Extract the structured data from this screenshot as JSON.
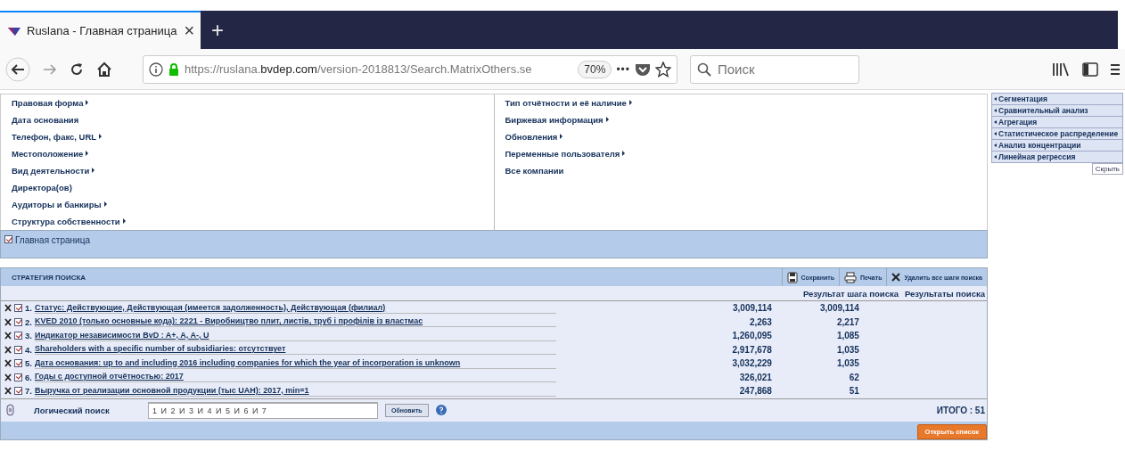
{
  "browser": {
    "tab": {
      "title": "Ruslana - Главная страница",
      "close": "×"
    },
    "new_tab": "+",
    "url": "https://ruslana.**bvdep.com**/version-2018813/Search.MatrixOthers.se",
    "zoom": "70%",
    "more": "•••",
    "search": {
      "placeholder": "Поиск"
    }
  },
  "criteria": {
    "left": [
      {
        "label": "Правовая форма",
        "submenu": true
      },
      {
        "label": "Дата основания",
        "submenu": false
      },
      {
        "label": "Телефон, факс, URL",
        "submenu": true
      },
      {
        "label": "Местоположение",
        "submenu": true
      },
      {
        "label": "Вид деятельности",
        "submenu": true
      },
      {
        "label": "Директора(ов)",
        "submenu": false
      },
      {
        "label": "Аудиторы и банкиры",
        "submenu": true
      },
      {
        "label": "Структура собственности",
        "submenu": true
      }
    ],
    "right": [
      {
        "label": "Тип отчётности и её наличие",
        "submenu": true
      },
      {
        "label": "Биржевая информация",
        "submenu": true
      },
      {
        "label": "Обновления",
        "submenu": true
      },
      {
        "label": "Переменные пользователя",
        "submenu": true
      },
      {
        "label": "Все компании",
        "submenu": false
      }
    ]
  },
  "home_bar": {
    "label": "Главная страница",
    "checked": true
  },
  "sidebar": {
    "items": [
      "Сегментация",
      "Сравнительный анализ",
      "Агрегация",
      "Статистическое распределение",
      "Анализ концентрации",
      "Линейная регрессия"
    ],
    "hide_button": "Скрыть"
  },
  "strategy": {
    "title": "СТРАТЕГИЯ ПОИСКА",
    "actions": [
      {
        "kind": "save",
        "label": "Сохранить"
      },
      {
        "kind": "print",
        "label": "Печать"
      },
      {
        "kind": "delete",
        "label": "Удалить все шаги поиска"
      }
    ],
    "columns": [
      "Результат шага поиска",
      "Результаты поиска"
    ],
    "steps": [
      {
        "number": "1.",
        "text": "Статус: Действующие, Действующая (имеется задолженность), Действующая (филиал)",
        "checked": true,
        "step_result": "3,009,114",
        "total": "3,009,114"
      },
      {
        "number": "2.",
        "text": "KVED 2010 (только основные кода): 2221 - Виробництво плит, листів, труб і профілів із властмас",
        "checked": true,
        "step_result": "2,263",
        "total": "2,217"
      },
      {
        "number": "3.",
        "text": "Индикатор независимости BvD : A+, A, A-, U",
        "checked": true,
        "step_result": "1,260,095",
        "total": "1,085"
      },
      {
        "number": "4.",
        "text": "Shareholders with a specific number of subsidiaries: отсутствует",
        "checked": true,
        "step_result": "2,917,678",
        "total": "1,035"
      },
      {
        "number": "5.",
        "text": "Дата основания: up to and including 2016 including companies for which the year of incorporation is unknown",
        "checked": true,
        "step_result": "3,032,229",
        "total": "1,035"
      },
      {
        "number": "6.",
        "text": "Годы с доступной отчётностью: 2017",
        "checked": true,
        "step_result": "326,021",
        "total": "62"
      },
      {
        "number": "7.",
        "text": "Выручка от реализации основной продукции (тыс UAH): 2017, min=1",
        "checked": true,
        "step_result": "247,868",
        "total": "51"
      }
    ],
    "logic_label": "Логический поиск",
    "logic_value": "1 И 2 И 3 И 4 И 5 И 6 И 7",
    "update_button": "Обновить",
    "total": "ИТОГО : 51",
    "open_button": "Открыть список"
  }
}
